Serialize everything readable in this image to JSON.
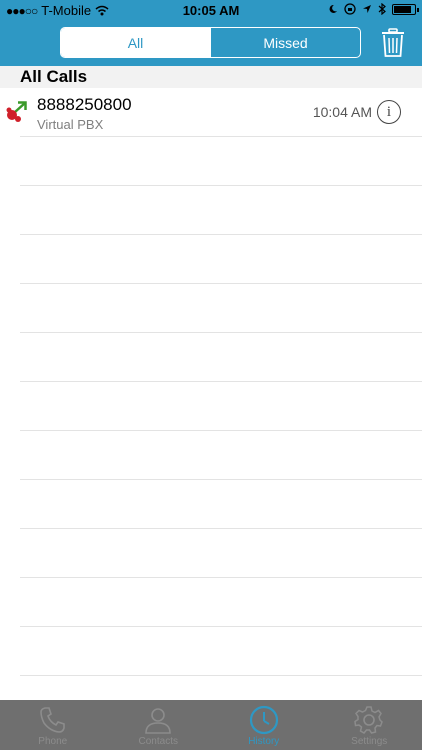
{
  "status_bar": {
    "signal": "●●●○○",
    "carrier": "T-Mobile",
    "time": "10:05 AM",
    "battery_level": 0.85
  },
  "header": {
    "segments": [
      {
        "label": "All",
        "selected": true
      },
      {
        "label": "Missed",
        "selected": false
      }
    ],
    "trash_icon": "trash-icon"
  },
  "section": {
    "title": "All Calls"
  },
  "calls": [
    {
      "number": "8888250800",
      "source": "Virtual PBX",
      "time": "10:04 AM",
      "icon": "outgoing-call-icon"
    }
  ],
  "tabs": [
    {
      "label": "Phone",
      "icon": "phone-icon",
      "active": false
    },
    {
      "label": "Contacts",
      "icon": "contacts-icon",
      "active": false
    },
    {
      "label": "History",
      "icon": "clock-icon",
      "active": true
    },
    {
      "label": "Settings",
      "icon": "gear-icon",
      "active": false
    }
  ],
  "colors": {
    "accent": "#2e98c4",
    "tabbar": "#6f6f6f",
    "call_icon_red": "#d0202a",
    "call_icon_green": "#3a9a2a"
  }
}
